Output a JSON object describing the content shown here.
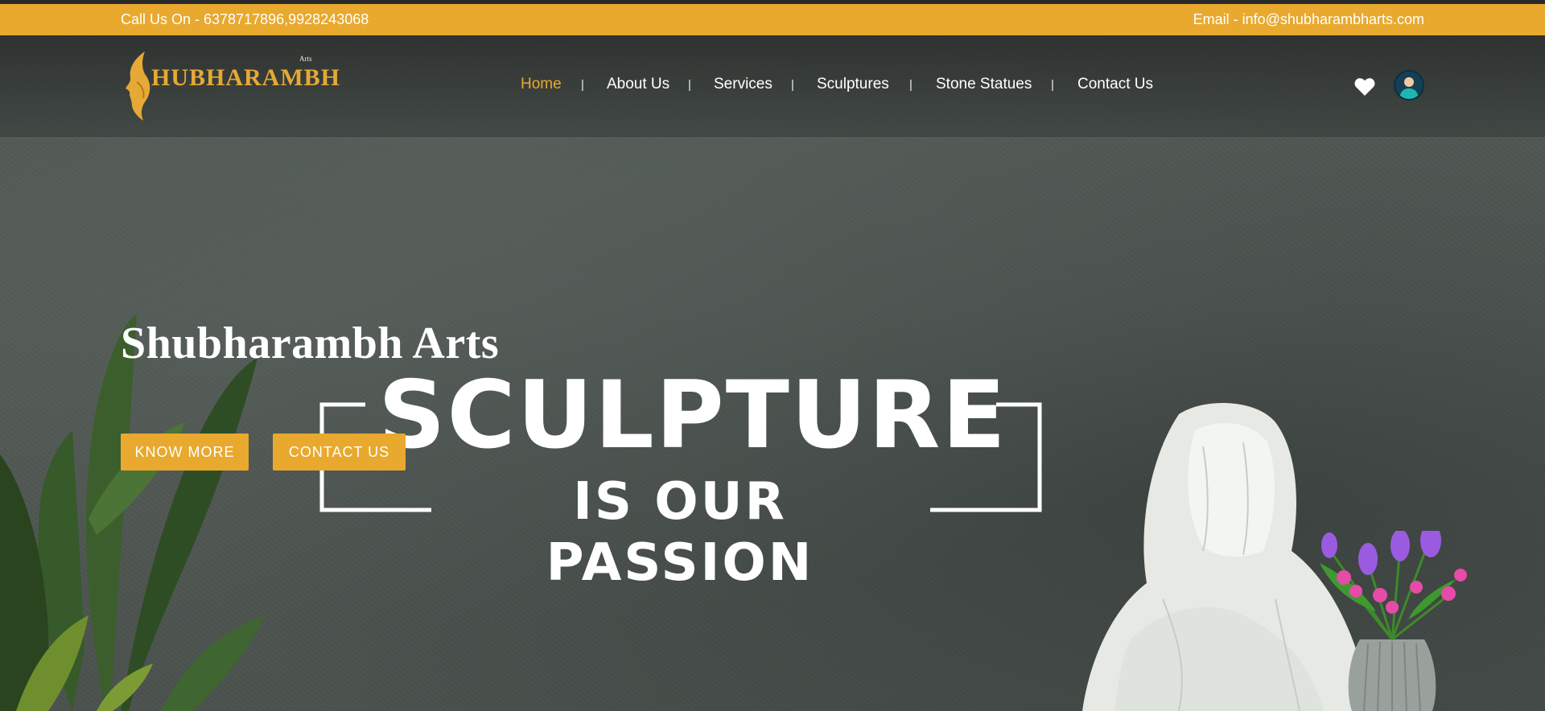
{
  "topbar": {
    "phone": "Call Us On - 6378717896,9928243068",
    "email": "Email - info@shubharambharts.com"
  },
  "logo": {
    "arts": "Arts",
    "word": "HUBHARAMBH"
  },
  "nav": {
    "items": [
      {
        "label": "Home",
        "active": true
      },
      {
        "label": "About Us"
      },
      {
        "label": "Services"
      },
      {
        "label": "Sculptures"
      },
      {
        "label": "Stone Statues"
      },
      {
        "label": "Contact Us"
      }
    ],
    "separator": "|"
  },
  "header_icons": {
    "wishlist": "heart-icon",
    "account": "user-avatar-icon"
  },
  "hero": {
    "brand": "Shubharambh Arts",
    "headline_1": "SCULPTURE",
    "headline_2": "IS OUR PASSION",
    "buttons": {
      "know_more": "KNOW MORE",
      "contact_us": "CONTACT US"
    }
  },
  "colors": {
    "accent": "#e8a92e",
    "background": "#4f5551",
    "text": "#ffffff"
  }
}
